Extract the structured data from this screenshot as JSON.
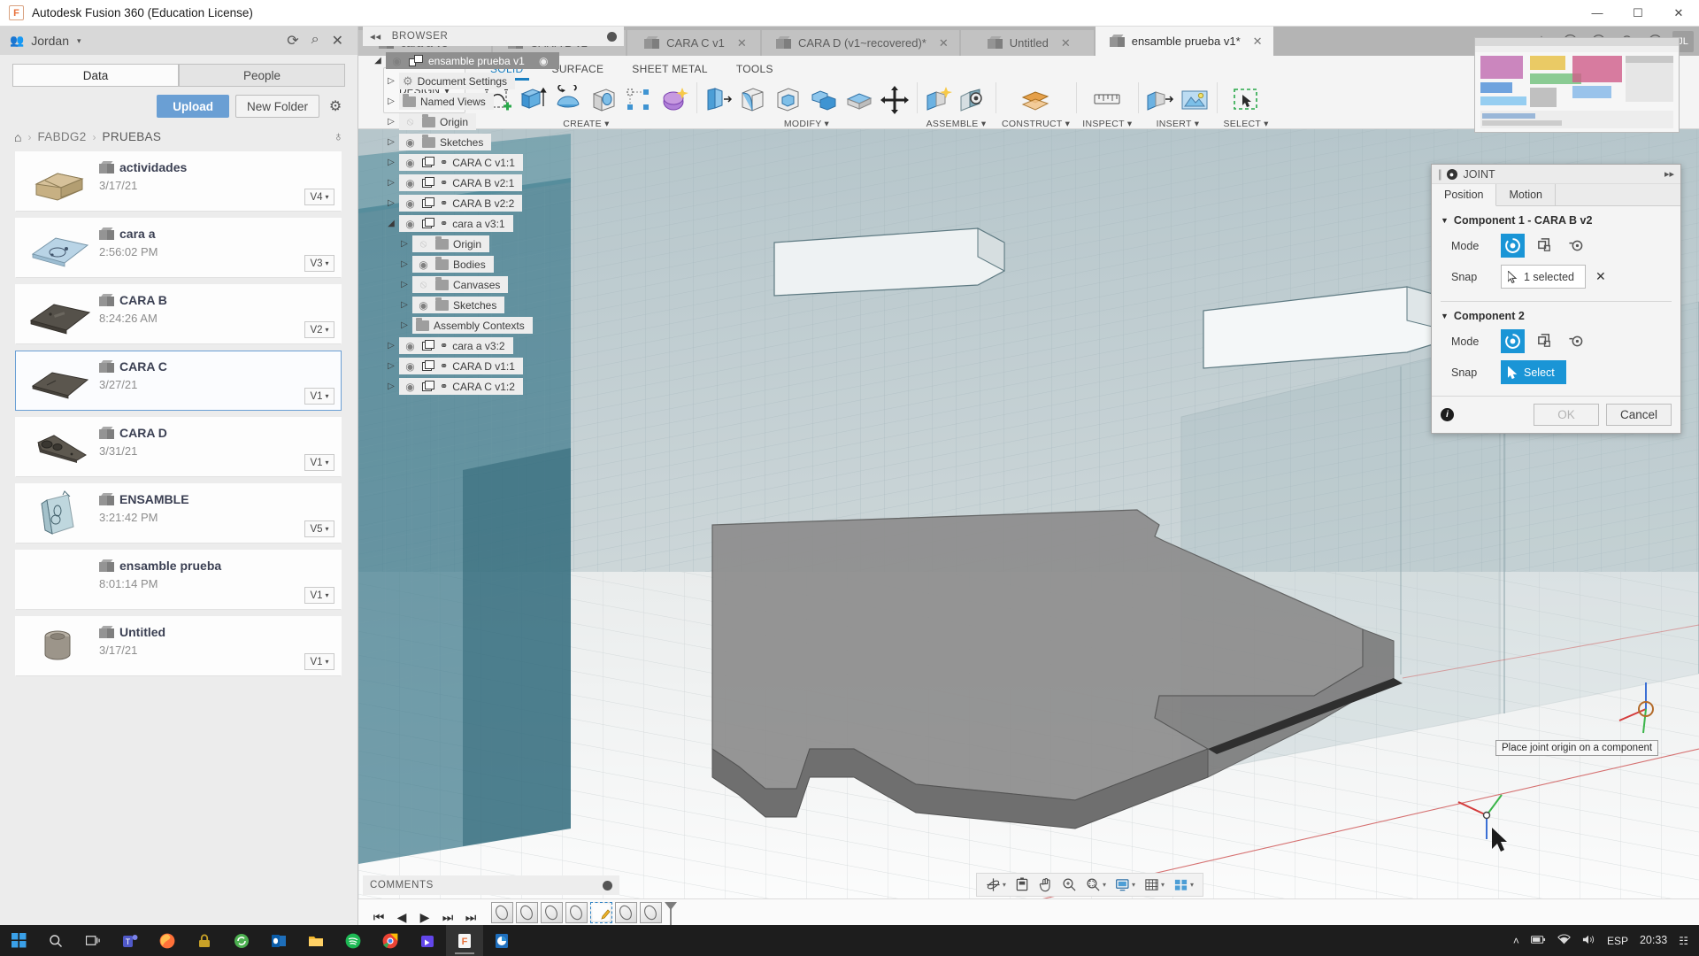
{
  "window": {
    "title": "Autodesk Fusion 360 (Education License)",
    "logo_text": "F",
    "minimize": "—",
    "maximize": "☐",
    "close": "✕"
  },
  "data_panel": {
    "team_name": "Jordan",
    "team_caret": "▾",
    "team_icon": "people-icon",
    "refresh_icon": "⟳",
    "search_icon": "⌕",
    "close_icon": "✕",
    "tabs": [
      {
        "label": "Data",
        "active": true
      },
      {
        "label": "People",
        "active": false
      }
    ],
    "upload_label": "Upload",
    "new_folder_label": "New Folder",
    "settings_icon": "⚙",
    "breadcrumb": {
      "home_icon": "⌂",
      "sep": "›",
      "items": [
        "FABDG2",
        "PRUEBAS"
      ]
    },
    "globe_icon": "♁",
    "items": [
      {
        "name": "actividades",
        "date": "3/17/21",
        "version": "V4",
        "selected": false,
        "thumb": "tan-block"
      },
      {
        "name": "cara a",
        "date": "2:56:02 PM",
        "version": "V3",
        "selected": false,
        "thumb": "blue-sheet"
      },
      {
        "name": "CARA B",
        "date": "8:24:26 AM",
        "version": "V2",
        "selected": false,
        "thumb": "dark-plate"
      },
      {
        "name": "CARA C",
        "date": "3/27/21",
        "version": "V1",
        "selected": true,
        "thumb": "dark-plate2"
      },
      {
        "name": "CARA D",
        "date": "3/31/21",
        "version": "V1",
        "selected": false,
        "thumb": "key-plate"
      },
      {
        "name": "ENSAMBLE",
        "date": "3:21:42 PM",
        "version": "V5",
        "selected": false,
        "thumb": "glass-box"
      },
      {
        "name": "ensamble prueba",
        "date": "8:01:14 PM",
        "version": "V1",
        "selected": false,
        "thumb": "none"
      },
      {
        "name": "Untitled",
        "date": "3/17/21",
        "version": "V1",
        "selected": false,
        "thumb": "cylinder"
      }
    ]
  },
  "document_tabs": {
    "tabs": [
      {
        "label": "cara a v3*",
        "active": false
      },
      {
        "label": "CARA B v2*",
        "active": false
      },
      {
        "label": "CARA C v1",
        "active": false
      },
      {
        "label": "CARA D (v1~recovered)*",
        "active": false
      },
      {
        "label": "Untitled",
        "active": false
      },
      {
        "label": "ensamble prueba v1*",
        "active": true
      }
    ],
    "close_icon": "✕",
    "dropdown_icon": "⌄",
    "add_icon": "＋",
    "right_icons": [
      "extensions-icon",
      "jobstatus-icon",
      "notifications-icon",
      "help-icon"
    ],
    "avatar_initials": "JL"
  },
  "ribbon": {
    "design_label": "DESIGN",
    "design_caret": "▾",
    "env_tabs": [
      {
        "label": "SOLID",
        "active": true
      },
      {
        "label": "SURFACE",
        "active": false
      },
      {
        "label": "SHEET METAL",
        "active": false
      },
      {
        "label": "TOOLS",
        "active": false
      }
    ],
    "groups": [
      {
        "label": "CREATE",
        "caret": "▾",
        "icons": [
          "new-sketch-icon",
          "extrude-icon",
          "revolve-icon",
          "hole-icon",
          "pattern-icon",
          "form-icon"
        ]
      },
      {
        "label": "MODIFY",
        "caret": "▾",
        "icons": [
          "press-pull-icon",
          "fillet-icon",
          "shell-icon",
          "combine-icon",
          "split-face-icon",
          "move-copy-icon"
        ]
      },
      {
        "label": "ASSEMBLE",
        "caret": "▾",
        "icons": [
          "new-component-icon",
          "joint-icon"
        ]
      },
      {
        "label": "CONSTRUCT",
        "caret": "▾",
        "icons": [
          "offset-plane-icon"
        ]
      },
      {
        "label": "INSPECT",
        "caret": "▾",
        "icons": [
          "measure-icon"
        ]
      },
      {
        "label": "INSERT",
        "caret": "▾",
        "icons": [
          "insert-derive-icon",
          "insert-canvas-icon"
        ]
      },
      {
        "label": "SELECT",
        "caret": "▾",
        "icons": [
          "select-window-icon"
        ]
      }
    ]
  },
  "browser": {
    "title": "BROWSER",
    "collapse_icon": "◂◂",
    "pin_icon": "pin-icon",
    "nodes": [
      {
        "label": "ensamble prueba v1",
        "indent": 0,
        "arrow": "down",
        "eye": "on",
        "icon": "assembly",
        "selected": true,
        "badge": "eye-toggle"
      },
      {
        "label": "Document Settings",
        "indent": 1,
        "arrow": "right",
        "eye": "none",
        "icon": "gear"
      },
      {
        "label": "Named Views",
        "indent": 1,
        "arrow": "right",
        "eye": "none",
        "icon": "folder"
      },
      {
        "label": "Origin",
        "indent": 1,
        "arrow": "right",
        "eye": "off",
        "icon": "folder"
      },
      {
        "label": "Sketches",
        "indent": 1,
        "arrow": "right",
        "eye": "on",
        "icon": "folder"
      },
      {
        "label": "CARA C v1:1",
        "indent": 1,
        "arrow": "right",
        "eye": "on",
        "icon": "component"
      },
      {
        "label": "CARA B v2:1",
        "indent": 1,
        "arrow": "right",
        "eye": "on",
        "icon": "component"
      },
      {
        "label": "CARA B v2:2",
        "indent": 1,
        "arrow": "right",
        "eye": "on",
        "icon": "component"
      },
      {
        "label": "cara a v3:1",
        "indent": 1,
        "arrow": "down",
        "eye": "on",
        "icon": "component"
      },
      {
        "label": "Origin",
        "indent": 2,
        "arrow": "right",
        "eye": "off",
        "icon": "folder"
      },
      {
        "label": "Bodies",
        "indent": 2,
        "arrow": "right",
        "eye": "on",
        "icon": "folder"
      },
      {
        "label": "Canvases",
        "indent": 2,
        "arrow": "right",
        "eye": "off",
        "icon": "folder"
      },
      {
        "label": "Sketches",
        "indent": 2,
        "arrow": "right",
        "eye": "on",
        "icon": "folder"
      },
      {
        "label": "Assembly Contexts",
        "indent": 2,
        "arrow": "right",
        "eye": "none",
        "icon": "folder"
      },
      {
        "label": "cara a v3:2",
        "indent": 1,
        "arrow": "right",
        "eye": "on",
        "icon": "component"
      },
      {
        "label": "CARA D v1:1",
        "indent": 1,
        "arrow": "right",
        "eye": "on",
        "icon": "component"
      },
      {
        "label": "CARA C v1:2",
        "indent": 1,
        "arrow": "right",
        "eye": "on",
        "icon": "component"
      }
    ]
  },
  "joint_dialog": {
    "title": "JOINT",
    "collapse_icon": "●",
    "expand_icon": "▸▸",
    "tabs": [
      {
        "label": "Position",
        "active": true
      },
      {
        "label": "Motion",
        "active": false
      }
    ],
    "component1": {
      "title": "Component 1 - CARA B v2",
      "triangle": "▼",
      "mode_label": "Mode",
      "snap_label": "Snap",
      "snap_value": "1 selected",
      "clear_icon": "✕",
      "mode_icons": [
        "rotate-mode-icon",
        "planar-mode-icon",
        "point-mode-icon"
      ],
      "active_mode": 0
    },
    "component2": {
      "title": "Component 2",
      "triangle": "▼",
      "mode_label": "Mode",
      "snap_label": "Snap",
      "snap_value": "Select",
      "mode_icons": [
        "rotate-mode-icon",
        "planar-mode-icon",
        "point-mode-icon"
      ],
      "active_mode": 0
    },
    "info_icon": "i",
    "ok_label": "OK",
    "cancel_label": "Cancel"
  },
  "tooltip": {
    "text": "Place joint origin on a component"
  },
  "comments": {
    "label": "COMMENTS",
    "pin_icon": "pin-icon"
  },
  "nav_toolbar": {
    "buttons": [
      {
        "name": "orbit-icon",
        "glyph": "✥",
        "caret": "▾"
      },
      {
        "name": "look-at-icon",
        "glyph": "Ὓ9",
        "caret": ""
      },
      {
        "name": "pan-icon",
        "glyph": "✋",
        "caret": ""
      },
      {
        "name": "zoom-icon",
        "glyph": "⚲",
        "caret": ""
      },
      {
        "name": "fit-icon",
        "glyph": "⚲",
        "caret": "▾"
      },
      {
        "name": "display-settings-icon",
        "glyph": "▣",
        "caret": "▾"
      },
      {
        "name": "grid-snaps-icon",
        "glyph": "▒",
        "caret": "▾"
      },
      {
        "name": "viewports-icon",
        "glyph": "⊞",
        "caret": "▾"
      }
    ]
  },
  "timeline": {
    "controls": [
      "⏮",
      "◀",
      "▶",
      "⏭",
      "⏭"
    ],
    "chip_count": 7,
    "active_chip_index": 4
  },
  "taskbar": {
    "start_icon": "windows-icon",
    "search_icon": "⌕",
    "taskview_icon": "□",
    "apps": [
      {
        "name": "teams-icon",
        "color": "#4b53bc",
        "letter": "T"
      },
      {
        "name": "firefox-icon",
        "color": "#e66000",
        "letter": ""
      },
      {
        "name": "lock-icon",
        "color": "#c9a227",
        "letter": ""
      },
      {
        "name": "sync-icon",
        "color": "#5a8f3d",
        "letter": ""
      },
      {
        "name": "outlook-icon",
        "color": "#0a6cbb",
        "letter": "O"
      },
      {
        "name": "explorer-icon",
        "color": "#e7b343",
        "letter": ""
      },
      {
        "name": "spotify-icon",
        "color": "#1db954",
        "letter": ""
      },
      {
        "name": "chrome-icon",
        "color": "#4285f4",
        "letter": ""
      },
      {
        "name": "store-icon",
        "color": "#6246ea",
        "letter": ""
      },
      {
        "name": "fusion360-icon",
        "color": "#f4a07a",
        "letter": "F"
      },
      {
        "name": "powerpoint-icon",
        "color": "#c43e1c",
        "letter": "P"
      }
    ],
    "tray_icons": [
      "˄",
      "🔋",
      "📶",
      "🔊"
    ],
    "language": "ESP",
    "clock_time": "20:33",
    "action_center_icon": "☷"
  },
  "colors": {
    "accent_blue": "#1a95d6",
    "upload_blue": "#6a9fd4",
    "env_active": "#1a7fc1",
    "selection_border": "#6a9fd4"
  }
}
